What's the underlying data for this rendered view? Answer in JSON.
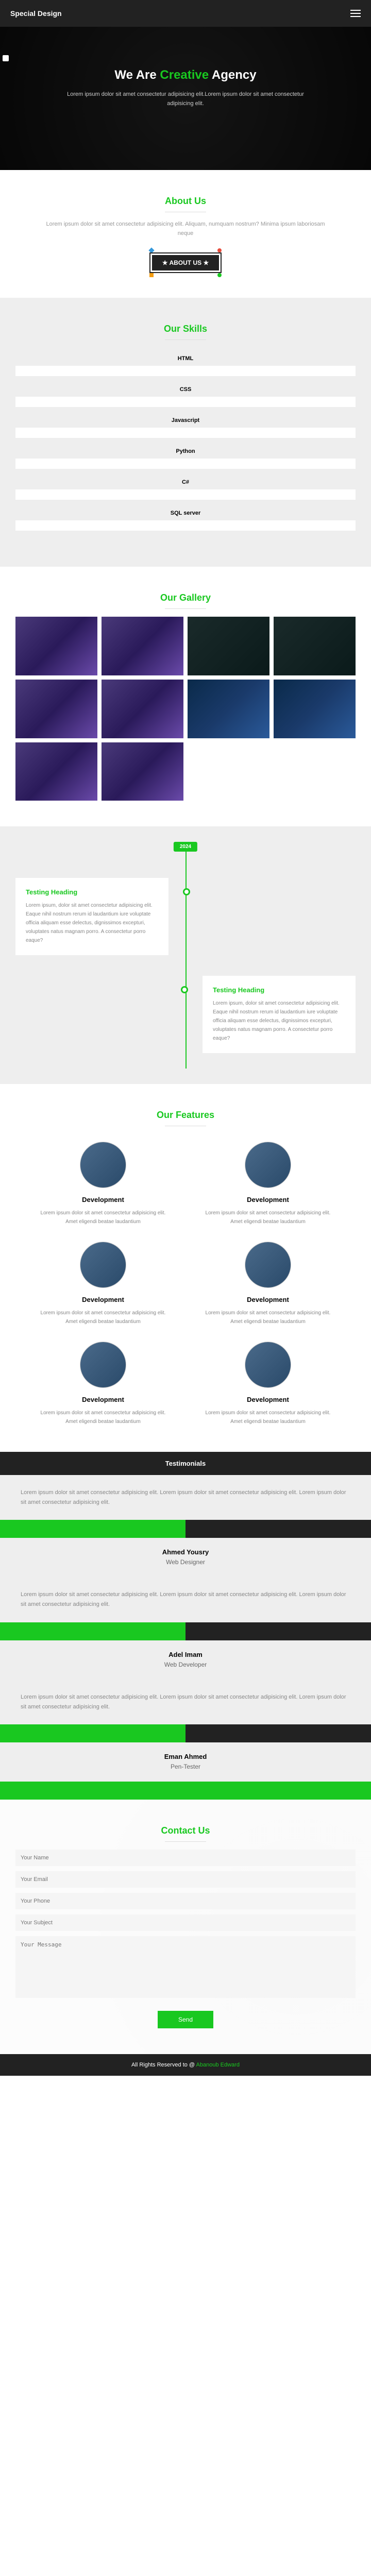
{
  "header": {
    "logo": "Special Design"
  },
  "landing": {
    "title_pre": "We Are ",
    "title_highlight": "Creative",
    "title_post": " Agency",
    "desc": "Lorem ipsum dolor sit amet consectetur adipisicing elit.Lorem ipsum dolor sit amet consectetur adipisicing elit."
  },
  "about": {
    "title": "About Us",
    "desc": "Lorem ipsum dolor sit amet consectetur adipisicing elit. Aliquam, numquam nostrum? Minima ipsum laboriosam neque",
    "badge": "★ ABOUT US ★"
  },
  "skills": {
    "title": "Our Skills",
    "items": [
      {
        "name": "HTML",
        "value": 0
      },
      {
        "name": "CSS",
        "value": 0
      },
      {
        "name": "Javascript",
        "value": 0
      },
      {
        "name": "Python",
        "value": 0
      },
      {
        "name": "C#",
        "value": 0
      },
      {
        "name": "SQL server",
        "value": 0
      }
    ]
  },
  "gallery": {
    "title": "Our Gallery"
  },
  "timeline": {
    "year": "2024",
    "items": [
      {
        "heading": "Testing Heading",
        "text": "Lorem ipsum, dolor sit amet consectetur adipisicing elit. Eaque nihil nostrum rerum id laudantium iure voluptate officia aliquam esse delectus, dignissimos excepturi, voluptates natus magnam porro. A consectetur porro eaque?"
      },
      {
        "heading": "Testing Heading",
        "text": "Lorem ipsum, dolor sit amet consectetur adipisicing elit. Eaque nihil nostrum rerum id laudantium iure voluptate officia aliquam esse delectus, dignissimos excepturi, voluptates natus magnam porro. A consectetur porro eaque?"
      }
    ]
  },
  "features": {
    "title": "Our Features",
    "items": [
      {
        "title": "Development",
        "text": "Lorem ipsum dolor sit amet consectetur adipisicing elit. Amet eligendi beatae laudantium"
      },
      {
        "title": "Development",
        "text": "Lorem ipsum dolor sit amet consectetur adipisicing elit. Amet eligendi beatae laudantium"
      },
      {
        "title": "Development",
        "text": "Lorem ipsum dolor sit amet consectetur adipisicing elit. Amet eligendi beatae laudantium"
      },
      {
        "title": "Development",
        "text": "Lorem ipsum dolor sit amet consectetur adipisicing elit. Amet eligendi beatae laudantium"
      },
      {
        "title": "Development",
        "text": "Lorem ipsum dolor sit amet consectetur adipisicing elit. Amet eligendi beatae laudantium"
      },
      {
        "title": "Development",
        "text": "Lorem ipsum dolor sit amet consectetur adipisicing elit. Amet eligendi beatae laudantium"
      }
    ]
  },
  "testimonials": {
    "title": "Testimonials",
    "quote": "Lorem ipsum dolor sit amet consectetur adipisicing elit. Lorem ipsum dolor sit amet consectetur adipisicing elit. Lorem ipsum dolor sit amet consectetur adipisicing elit.",
    "items": [
      {
        "name": "Ahmed Yousry",
        "role": "Web Designer"
      },
      {
        "name": "Adel Imam",
        "role": "Web Developer"
      },
      {
        "name": "Eman Ahmed",
        "role": "Pen-Tester"
      }
    ]
  },
  "contact": {
    "title": "Contact Us",
    "placeholders": {
      "name": "Your Name",
      "email": "Your Email",
      "phone": "Your Phone",
      "subject": "Your Subject",
      "message": "Your Message"
    },
    "button": "Send"
  },
  "footer": {
    "text": "All Rights Reserved to @ ",
    "author": "Abanoub Edward"
  }
}
